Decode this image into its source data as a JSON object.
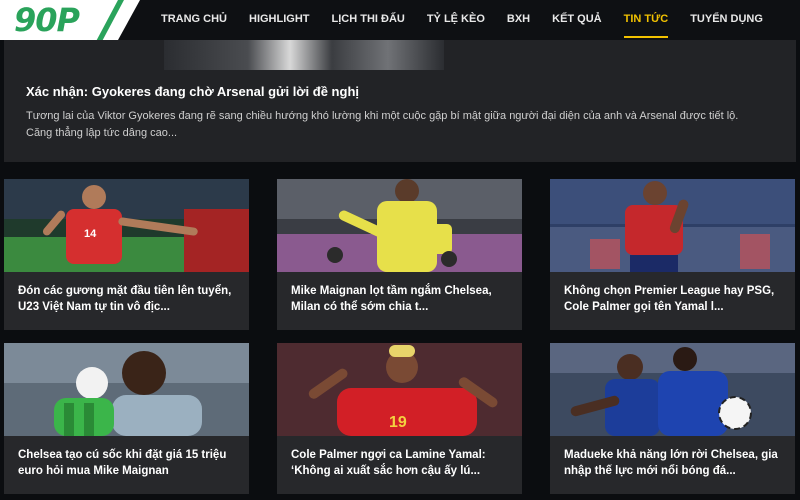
{
  "header": {
    "logo": "90P",
    "nav": [
      {
        "label": "TRANG CHỦ",
        "active": false
      },
      {
        "label": "HIGHLIGHT",
        "active": false
      },
      {
        "label": "LỊCH THI ĐẤU",
        "active": false
      },
      {
        "label": "TỶ LỆ KÈO",
        "active": false
      },
      {
        "label": "BXH",
        "active": false
      },
      {
        "label": "KẾT QUẢ",
        "active": false
      },
      {
        "label": "TIN TỨC",
        "active": true
      },
      {
        "label": "TUYỂN DỤNG",
        "active": false
      }
    ],
    "active_color": "#f2c200",
    "logo_color": "#2aa35b"
  },
  "hero": {
    "title": "Xác nhận: Gyokeres đang chờ Arsenal gửi lời đề nghị",
    "description": "Tương lai của Viktor Gyokeres đang rẽ sang chiều hướng khó lường khi một cuộc gặp bí mật giữa người đại diện của anh và Arsenal được tiết lộ. Căng thẳng lập tức dâng cao..."
  },
  "cards": [
    {
      "title": "Đón các gương mặt đầu tiên lên tuyển, U23 Việt Nam tự tin vô địc...",
      "image": "player-red-jersey-14"
    },
    {
      "title": "Mike Maignan lọt tầm ngắm Chelsea, Milan có thể sớm chia t...",
      "image": "goalkeeper-yellow-kit"
    },
    {
      "title": "Không chọn Premier League hay PSG, Cole Palmer gọi tên Yamal l...",
      "image": "player-spain-kit"
    },
    {
      "title": "Chelsea tạo cú sốc khi đặt giá 15 triệu euro hỏi mua Mike Maignan",
      "image": "goalkeeper-green-gloves"
    },
    {
      "title": "Cole Palmer ngợi ca Lamine Yamal: ‘Không ai xuất sắc hơn cậu ấy lú...",
      "image": "yamal-spain-19"
    },
    {
      "title": "Madueke khả năng lớn rời Chelsea, gia nhập thế lực mới nổi bóng đá...",
      "image": "chelsea-players-celebrating"
    }
  ]
}
